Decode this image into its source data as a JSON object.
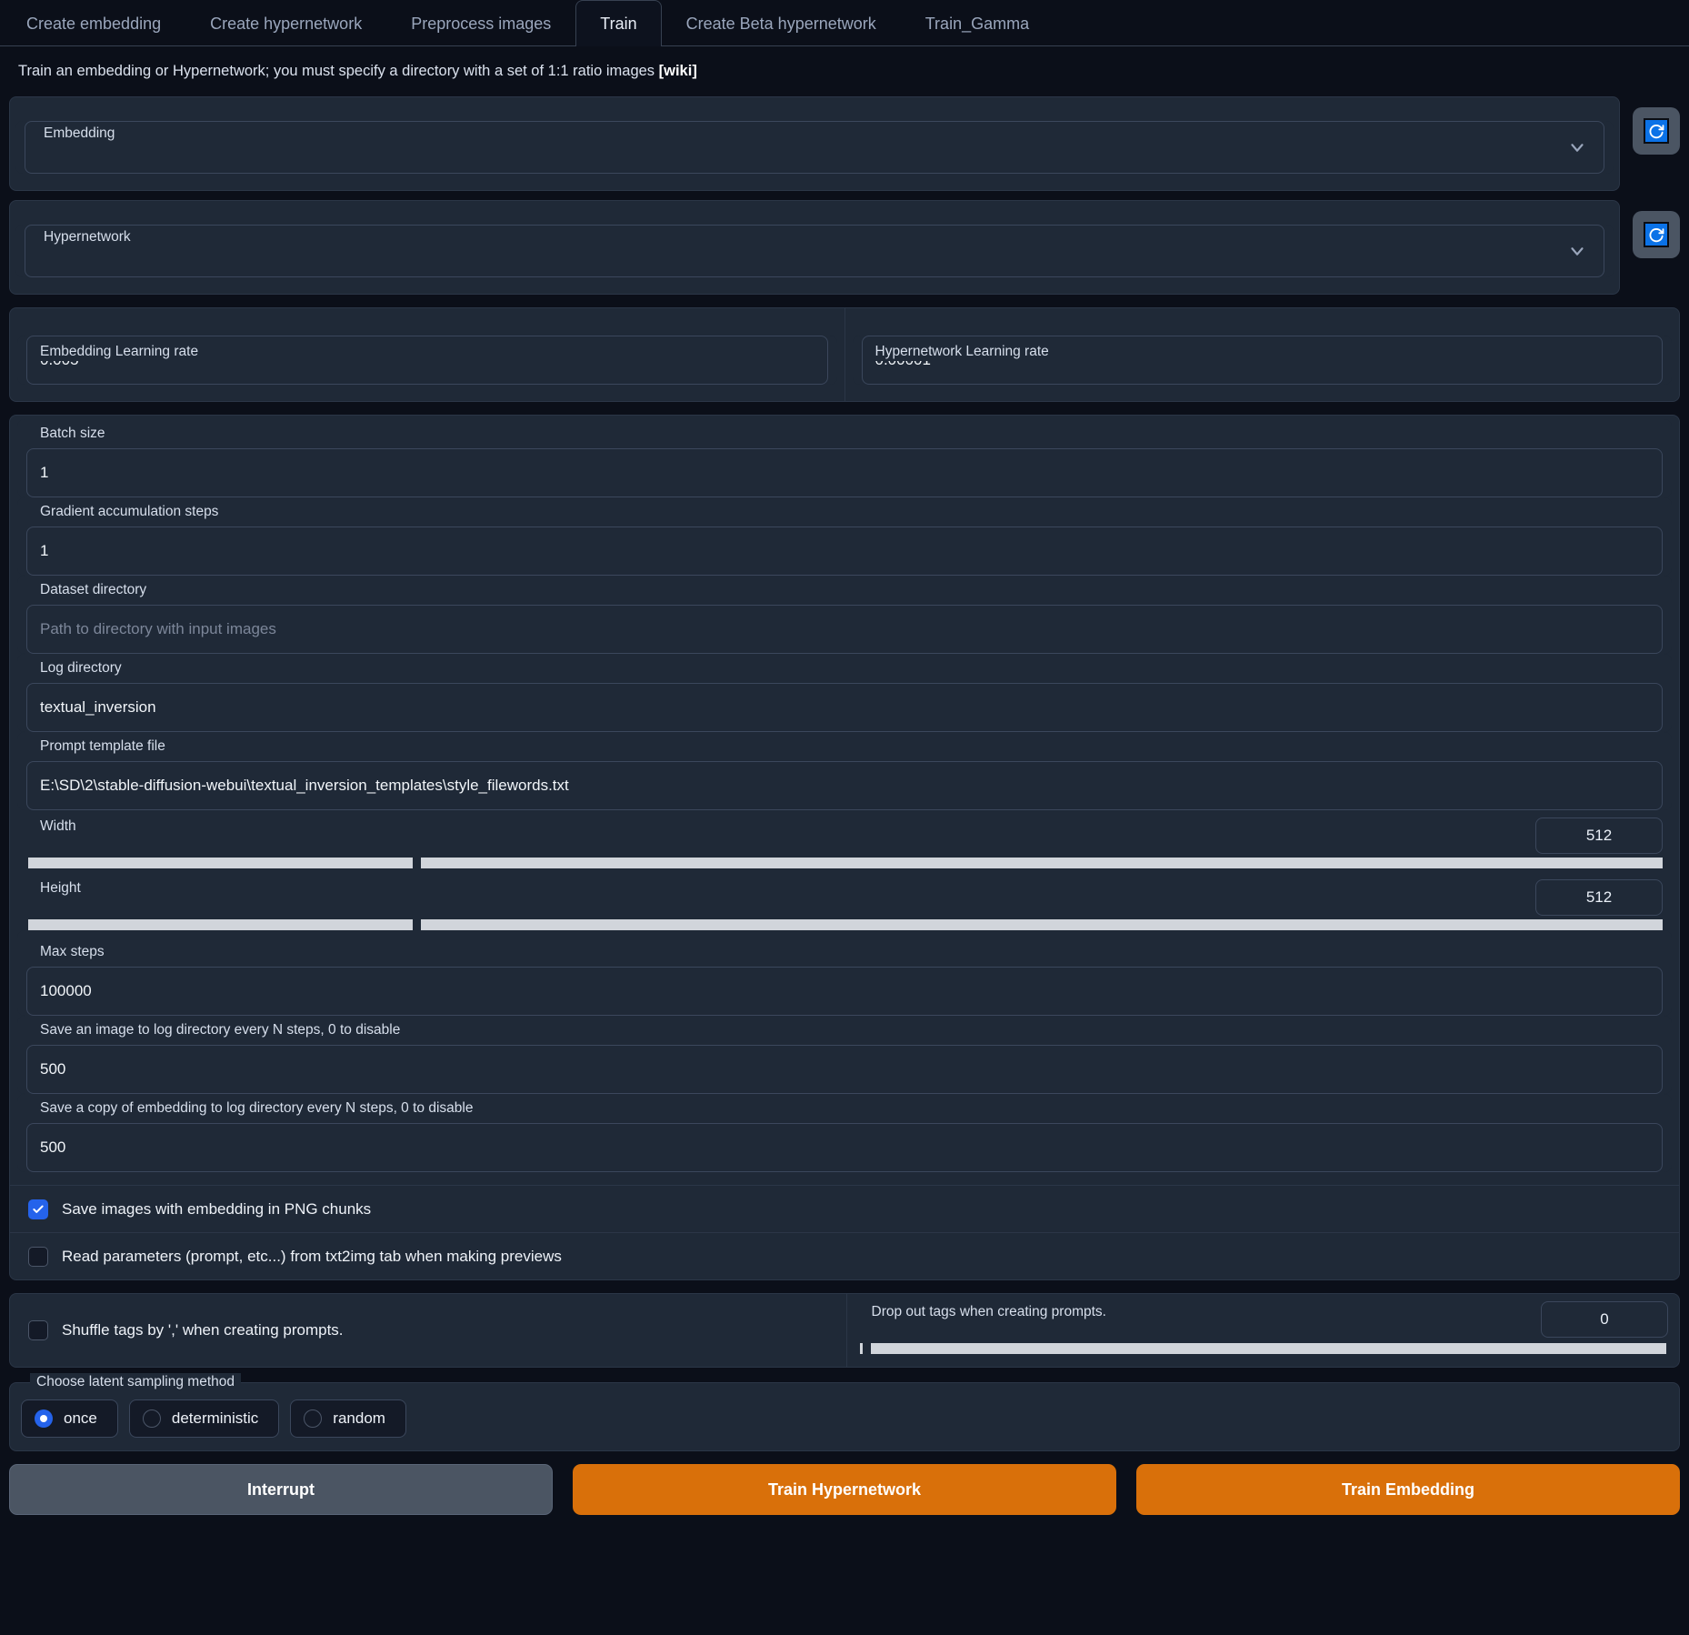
{
  "tabs": [
    {
      "label": "Create embedding",
      "active": false
    },
    {
      "label": "Create hypernetwork",
      "active": false
    },
    {
      "label": "Preprocess images",
      "active": false
    },
    {
      "label": "Train",
      "active": true
    },
    {
      "label": "Create Beta hypernetwork",
      "active": false
    },
    {
      "label": "Train_Gamma",
      "active": false
    }
  ],
  "description": {
    "text": "Train an embedding or Hypernetwork; you must specify a directory with a set of 1:1 ratio images ",
    "wiki": "[wiki]"
  },
  "embedding": {
    "label": "Embedding",
    "value": "",
    "refresh_title": "refresh"
  },
  "hypernetwork": {
    "label": "Hypernetwork",
    "value": "",
    "refresh_title": "refresh"
  },
  "learning_rates": {
    "embedding": {
      "label": "Embedding Learning rate",
      "value": "0.005"
    },
    "hypernetwork": {
      "label": "Hypernetwork Learning rate",
      "value": "0.00001"
    }
  },
  "fields": {
    "batch_size": {
      "label": "Batch size",
      "value": "1"
    },
    "gradient_accumulation": {
      "label": "Gradient accumulation steps",
      "value": "1"
    },
    "dataset_directory": {
      "label": "Dataset directory",
      "value": "",
      "placeholder": "Path to directory with input images"
    },
    "log_directory": {
      "label": "Log directory",
      "value": "textual_inversion"
    },
    "prompt_template": {
      "label": "Prompt template file",
      "value": "E:\\SD\\2\\stable-diffusion-webui\\textual_inversion_templates\\style_filewords.txt"
    },
    "max_steps": {
      "label": "Max steps",
      "value": "100000"
    },
    "save_image_every": {
      "label": "Save an image to log directory every N steps, 0 to disable",
      "value": "500"
    },
    "save_copy_every": {
      "label": "Save a copy of embedding to log directory every N steps, 0 to disable",
      "value": "500"
    }
  },
  "sliders": {
    "width": {
      "label": "Width",
      "value": "512",
      "fill_percent": 23.5
    },
    "height": {
      "label": "Height",
      "value": "512",
      "fill_percent": 23.5
    },
    "drop_out_tags": {
      "label": "Drop out tags when creating prompts.",
      "value": "0",
      "fill_percent": 0.4
    }
  },
  "checkboxes": [
    {
      "label": "Save images with embedding in PNG chunks",
      "checked": true
    },
    {
      "label": "Read parameters (prompt, etc...) from txt2img tab when making previews",
      "checked": false
    }
  ],
  "shuffle_tags": {
    "label": "Shuffle tags by ',' when creating prompts.",
    "checked": false
  },
  "latent_sampling": {
    "label": "Choose latent sampling method",
    "options": [
      {
        "label": "once",
        "selected": true
      },
      {
        "label": "deterministic",
        "selected": false
      },
      {
        "label": "random",
        "selected": false
      }
    ]
  },
  "buttons": {
    "interrupt": "Interrupt",
    "train_hypernetwork": "Train Hypernetwork",
    "train_embedding": "Train Embedding"
  },
  "colors": {
    "accent_orange": "#d9700a",
    "accent_blue": "#2563eb",
    "grey_button": "#4b5563",
    "panel": "#1f2937",
    "page_bg": "#0b0f19"
  },
  "icons": {
    "chevron": "chevron-down-icon",
    "refresh": "refresh-icon",
    "check": "check-icon"
  }
}
